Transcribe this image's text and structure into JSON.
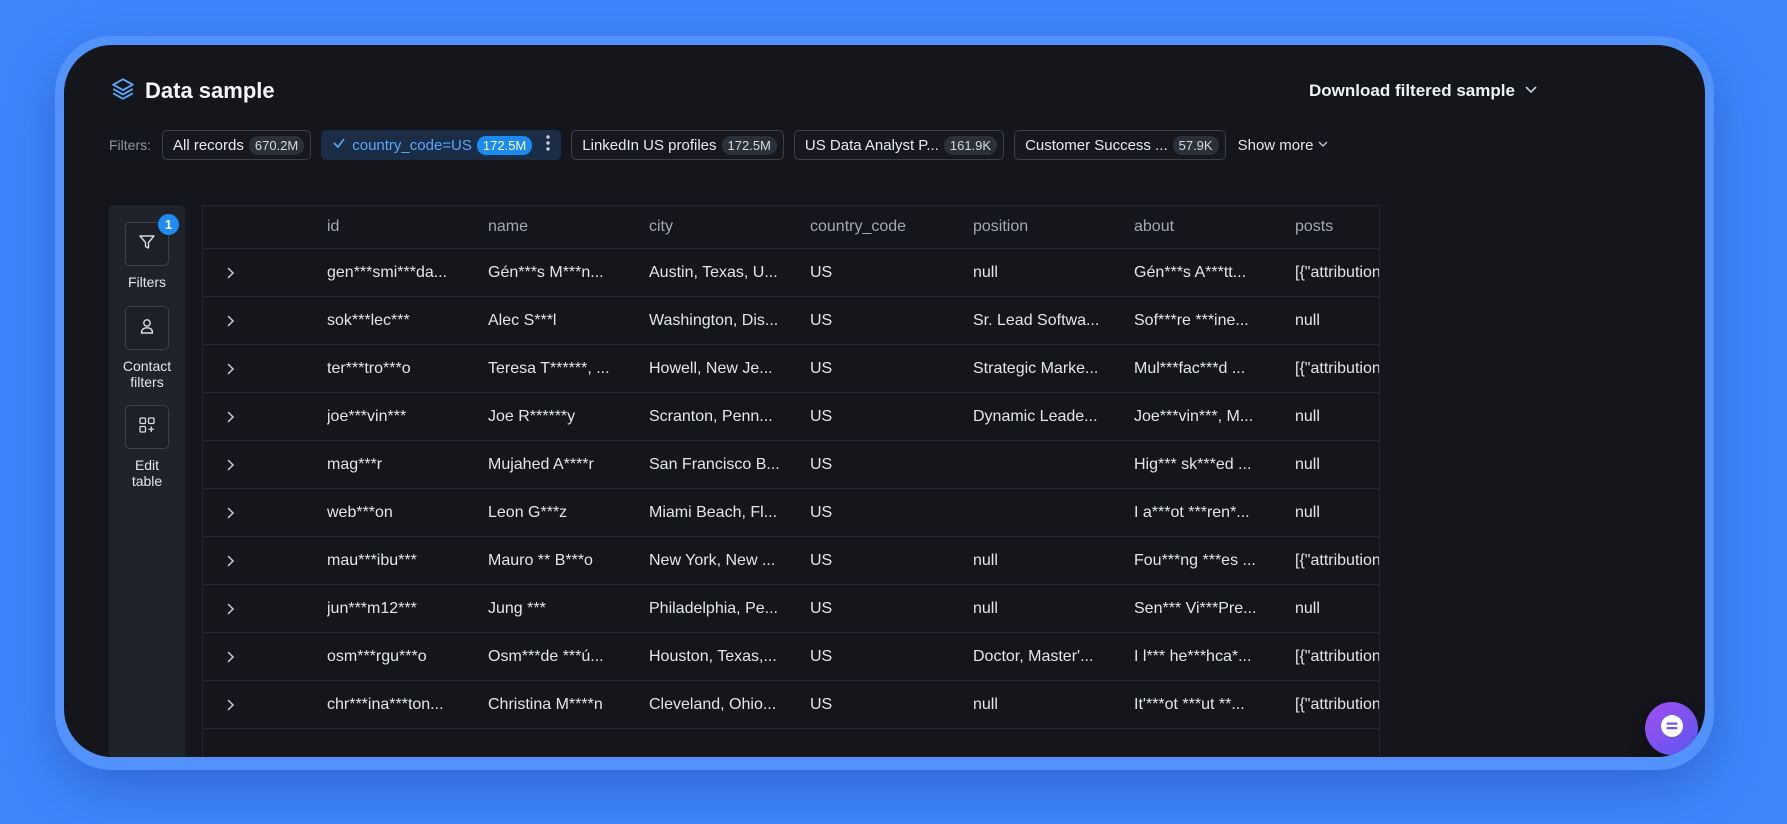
{
  "header": {
    "title": "Data sample",
    "download_label": "Download filtered sample"
  },
  "filters": {
    "label": "Filters:",
    "chips": [
      {
        "label": "All records",
        "count": "670.2M",
        "active": false
      },
      {
        "label": "country_code=US",
        "count": "172.5M",
        "active": true
      },
      {
        "label": "LinkedIn US profiles",
        "count": "172.5M",
        "active": false
      },
      {
        "label": "US Data Analyst P...",
        "count": "161.9K",
        "active": false
      },
      {
        "label": "Customer Success ...",
        "count": "57.9K",
        "active": false
      }
    ],
    "show_more": "Show more"
  },
  "sidebar": {
    "filters_label": "Filters",
    "filters_badge": "1",
    "contact_label_1": "Contact",
    "contact_label_2": "filters",
    "edit_label_1": "Edit",
    "edit_label_2": "table"
  },
  "table": {
    "columns": [
      "id",
      "name",
      "city",
      "country_code",
      "position",
      "about",
      "posts"
    ],
    "rows": [
      [
        "gen***smi***da...",
        "Gén***s M***n...",
        "Austin, Texas, U...",
        "US",
        "null",
        "Gén***s A***tt...",
        "[{\"attribution"
      ],
      [
        "sok***lec***",
        "Alec S***l",
        "Washington, Dis...",
        "US",
        "Sr. Lead Softwa...",
        "Sof***re ***ine...",
        "null"
      ],
      [
        "ter***tro***o",
        "Teresa T******, ...",
        "Howell, New Je...",
        "US",
        "Strategic Marke...",
        "Mul***fac***d ...",
        "[{\"attribution"
      ],
      [
        "joe***vin***",
        "Joe R******y",
        "Scranton, Penn...",
        "US",
        "Dynamic Leade...",
        "Joe***vin***, M...",
        "null"
      ],
      [
        "mag***r",
        "Mujahed A****r",
        "San Francisco B...",
        "US",
        "",
        "Hig*** sk***ed ...",
        "null"
      ],
      [
        "web***on",
        "Leon G***z",
        "Miami Beach, Fl...",
        "US",
        "",
        "I a***ot ***ren*...",
        "null"
      ],
      [
        "mau***ibu***",
        "Mauro ** B***o",
        "New York, New ...",
        "US",
        "null",
        "Fou***ng ***es ...",
        "[{\"attribution"
      ],
      [
        "jun***m12***",
        "Jung ***",
        "Philadelphia, Pe...",
        "US",
        "null",
        "Sen*** Vi***Pre...",
        "null"
      ],
      [
        "osm***rgu***o",
        "Osm***de ***ú...",
        "Houston, Texas,...",
        "US",
        "Doctor, Master'...",
        "I l*** he***hca*...",
        "[{\"attribution"
      ],
      [
        "chr***ina***ton...",
        "Christina M****n",
        "Cleveland, Ohio...",
        "US",
        "null",
        "It'***ot ***ut **...",
        "[{\"attribution"
      ]
    ]
  },
  "colors": {
    "background": "#3f86fd",
    "window": "#14161b",
    "accent": "#1d8cf3",
    "chat_gradient_start": "#a24df2",
    "chat_gradient_end": "#5a57f0"
  },
  "icons": [
    "layers-icon",
    "chevron-down-icon",
    "check-icon",
    "kebab-icon",
    "filter-icon",
    "user-icon",
    "grid-plus-icon",
    "chevron-right-icon",
    "chat-icon"
  ]
}
